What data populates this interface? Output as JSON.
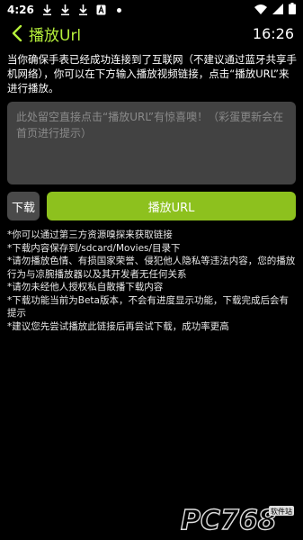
{
  "statusbar": {
    "time": "4:26",
    "icons": [
      "download-icon",
      "download-icon",
      "download-icon",
      "a-icon",
      "dot-icon",
      "wifi-icon",
      "signal-icon",
      "battery-icon"
    ]
  },
  "header": {
    "title": "播放Url",
    "clock": "16:26"
  },
  "info_text": "当你确保手表已经成功连接到了互联网（不建议通过蓝牙共享手机网络），你可以在下方输入播放视频链接，点击“播放URL”来进行播放。",
  "url_input": {
    "placeholder": "此处留空直接点击“播放URL”有惊喜噢！（彩蛋更新会在首页进行提示）"
  },
  "buttons": {
    "download": "下载",
    "play": "播放URL"
  },
  "notes": [
    "*你可以通过第三方资源嗅探来获取链接",
    "*下载内容保存到/sdcard/Movies/目录下",
    "*请勿播放色情、有损国家荣誉、侵犯他人隐私等违法内容，您的播放行为与凉腕播放器以及其开发者无任何关系",
    "*请勿未经他人授权私自散播下载内容",
    "*下载功能当前为Beta版本，不会有进度显示功能，下载完成后会有提示",
    "*建议您先尝试播放此链接后再尝试下载，成功率更高"
  ],
  "watermark": {
    "text": "PC768",
    "subtext": "软件站"
  },
  "colors": {
    "accent": "#8dc11e",
    "title": "#b6f03b",
    "input_bg": "#424242",
    "button_bg": "#4a4a4a"
  }
}
